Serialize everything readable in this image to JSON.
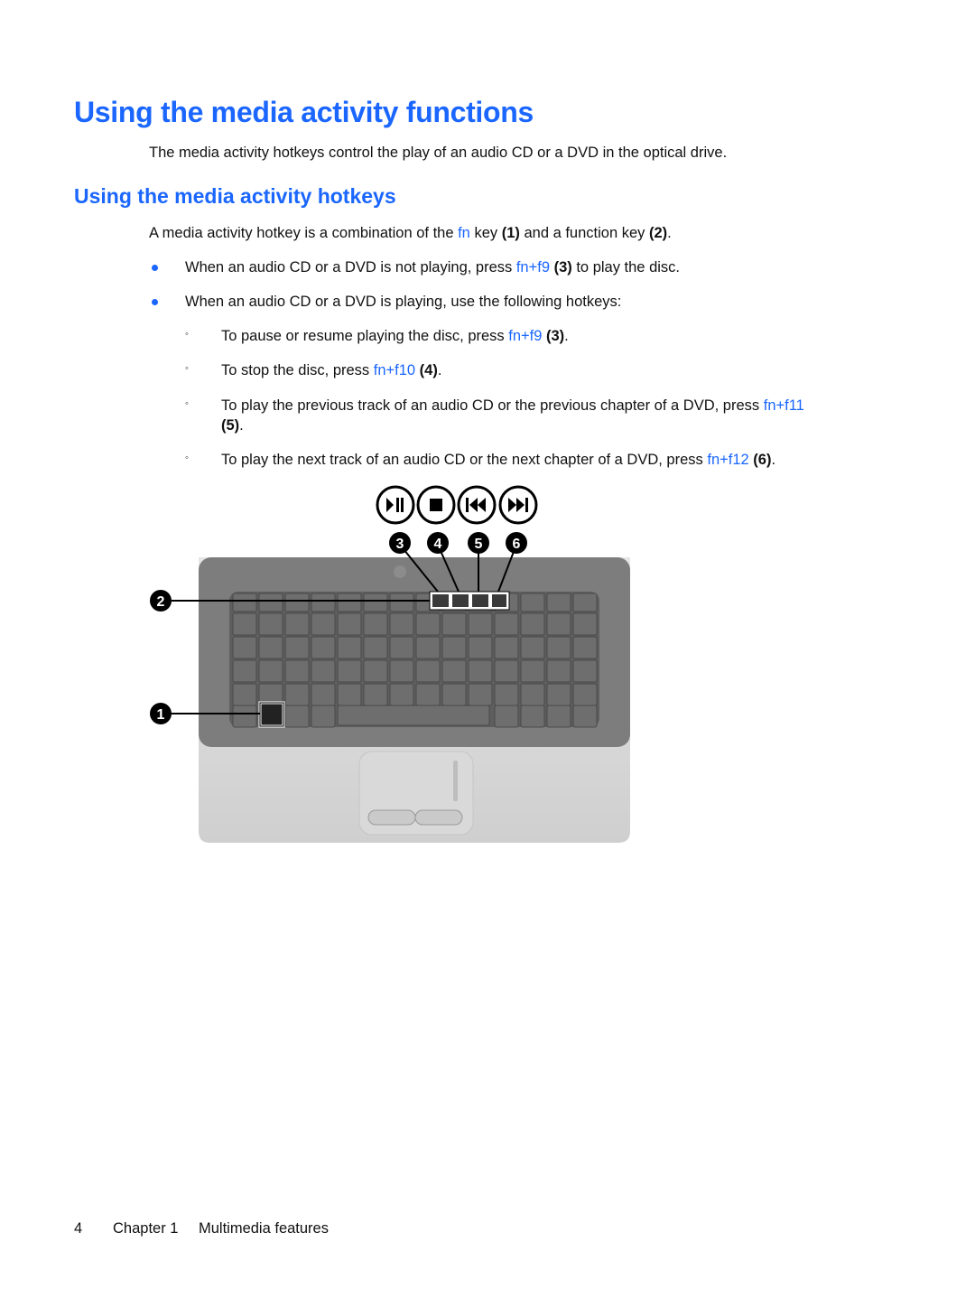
{
  "heading": "Using the media activity functions",
  "intro": "The media activity hotkeys control the play of an audio CD or a DVD in the optical drive.",
  "subheading": "Using the media activity hotkeys",
  "para": {
    "t1": "A media activity hotkey is a combination of the ",
    "fn": "fn",
    "t2": " key ",
    "n1": "(1)",
    "t3": " and a function key ",
    "n2": "(2)",
    "t4": "."
  },
  "bullets": [
    {
      "t1": "When an audio CD or a DVD is not playing, press ",
      "key": "fn+f9",
      "num": " (3)",
      "t2": " to play the disc."
    },
    {
      "t1": "When an audio CD or a DVD is playing, use the following hotkeys:"
    }
  ],
  "subbullets": [
    {
      "t1": "To pause or resume playing the disc, press ",
      "key": "fn+f9",
      "num": " (3)",
      "t2": "."
    },
    {
      "t1": "To stop the disc, press ",
      "key": "fn+f10",
      "num": " (4)",
      "t2": "."
    },
    {
      "t1": "To play the previous track of an audio CD or the previous chapter of a DVD, press ",
      "key": "fn+f11",
      "num": "(5)",
      "t2": "."
    },
    {
      "t1": "To play the next track of an audio CD or the next chapter of a DVD, press ",
      "key": "fn+f12",
      "num": " (6)",
      "t2": "."
    }
  ],
  "figure": {
    "media_icons": [
      "play-pause-icon",
      "stop-icon",
      "previous-track-icon",
      "next-track-icon"
    ],
    "callouts": [
      "1",
      "2",
      "3",
      "4",
      "5",
      "6"
    ]
  },
  "footer": {
    "page_number": "4",
    "chapter": "Chapter 1",
    "chapter_title": "Multimedia features"
  }
}
